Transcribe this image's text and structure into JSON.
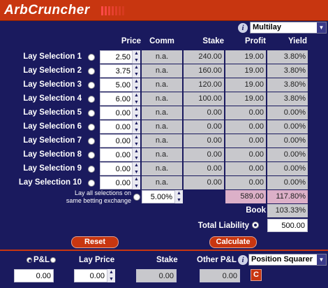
{
  "app": {
    "title": "ArbCruncher"
  },
  "exchange_select": {
    "value": "Multilay"
  },
  "headers": {
    "price": "Price",
    "comm": "Comm",
    "stake": "Stake",
    "profit": "Profit",
    "yield": "Yield"
  },
  "rows": [
    {
      "label": "Lay Selection 1",
      "price": "2.50",
      "comm": "n.a.",
      "stake": "240.00",
      "profit": "19.00",
      "yield": "3.80%"
    },
    {
      "label": "Lay Selection 2",
      "price": "3.75",
      "comm": "n.a.",
      "stake": "160.00",
      "profit": "19.00",
      "yield": "3.80%"
    },
    {
      "label": "Lay Selection 3",
      "price": "5.00",
      "comm": "n.a.",
      "stake": "120.00",
      "profit": "19.00",
      "yield": "3.80%"
    },
    {
      "label": "Lay Selection 4",
      "price": "6.00",
      "comm": "n.a.",
      "stake": "100.00",
      "profit": "19.00",
      "yield": "3.80%"
    },
    {
      "label": "Lay Selection 5",
      "price": "0.00",
      "comm": "n.a.",
      "stake": "0.00",
      "profit": "0.00",
      "yield": "0.00%"
    },
    {
      "label": "Lay Selection 6",
      "price": "0.00",
      "comm": "n.a.",
      "stake": "0.00",
      "profit": "0.00",
      "yield": "0.00%"
    },
    {
      "label": "Lay Selection 7",
      "price": "0.00",
      "comm": "n.a.",
      "stake": "0.00",
      "profit": "0.00",
      "yield": "0.00%"
    },
    {
      "label": "Lay Selection 8",
      "price": "0.00",
      "comm": "n.a.",
      "stake": "0.00",
      "profit": "0.00",
      "yield": "0.00%"
    },
    {
      "label": "Lay Selection 9",
      "price": "0.00",
      "comm": "n.a.",
      "stake": "0.00",
      "profit": "0.00",
      "yield": "0.00%"
    },
    {
      "label": "Lay Selection 10",
      "price": "0.00",
      "comm": "n.a.",
      "stake": "0.00",
      "profit": "0.00",
      "yield": "0.00%"
    }
  ],
  "same_exchange": {
    "label_line1": "Lay all selections on",
    "label_line2": "same betting exchange",
    "comm": "5.00%"
  },
  "totals": {
    "profit": "589.00",
    "yield": "117.80%",
    "book_label": "Book",
    "book": "103.33%",
    "liability_label": "Total Liability",
    "liability": "500.00"
  },
  "buttons": {
    "reset": "Reset",
    "calculate": "Calculate",
    "clear": "C"
  },
  "bottom": {
    "pl_label": "P&L",
    "lay_price_label": "Lay Price",
    "stake_label": "Stake",
    "other_pl_label": "Other P&L",
    "mode_select": "Position Squarer",
    "pl_value": "0.00",
    "lay_price_value": "0.00",
    "stake_value": "0.00",
    "other_pl_value": "0.00"
  },
  "colors": {
    "background": "#1a1a5e",
    "accent": "#c83610",
    "cell_grey": "#c8c8cc",
    "cell_pink": "#dcb0c8"
  }
}
